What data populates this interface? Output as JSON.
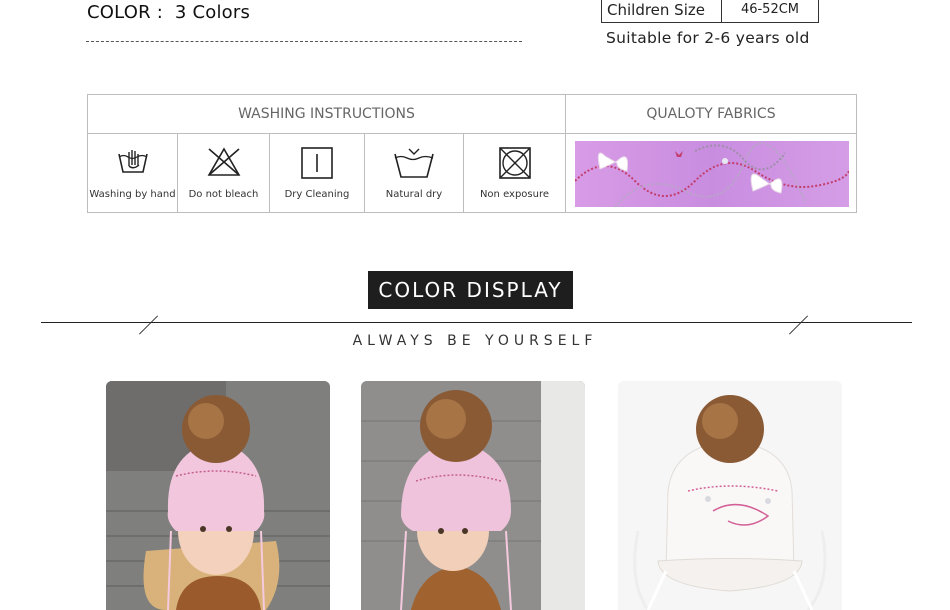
{
  "header": {
    "color_label": "COLOR :",
    "color_value": "3 Colors",
    "size_label": "Children Size",
    "size_value": "46-52CM",
    "age_text": "Suitable for 2-6 years old"
  },
  "instructions": {
    "header_left": "WASHING INSTRUCTIONS",
    "header_right": "QUALOTY FABRICS",
    "items": [
      {
        "label": "Washing by hand",
        "icon": "hand-wash-icon"
      },
      {
        "label": "Do not bleach",
        "icon": "no-bleach-icon"
      },
      {
        "label": "Dry Cleaning",
        "icon": "dry-cleaning-icon"
      },
      {
        "label": "Natural dry",
        "icon": "natural-dry-icon"
      },
      {
        "label": "Non exposure",
        "icon": "non-exposure-icon"
      }
    ]
  },
  "color_display": {
    "title": "COLOR DISPLAY",
    "tagline": "ALWAYS BE YOURSELF"
  },
  "photos": [
    {
      "name": "girl-pink-hat-photo-1"
    },
    {
      "name": "girl-pink-hat-photo-2"
    },
    {
      "name": "white-hat-product-photo"
    }
  ],
  "colors": {
    "pink_hat": "#f3c2dc",
    "white_hat": "#f7f4f2",
    "pompom": "#8a5a35",
    "fabric": "#d49be6",
    "title_bg": "#1e1e1e"
  }
}
